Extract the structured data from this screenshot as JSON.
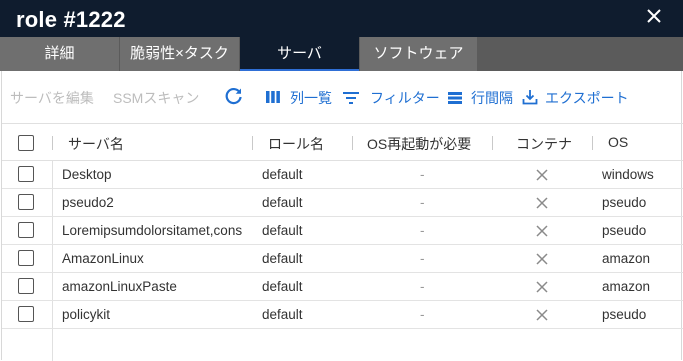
{
  "window": {
    "title": "role #1222",
    "close_icon": "close-icon"
  },
  "tabs": [
    {
      "label": "詳細",
      "active": false
    },
    {
      "label": "脆弱性×タスク",
      "active": false
    },
    {
      "label": "サーバ",
      "active": true
    },
    {
      "label": "ソフトウェア",
      "active": false
    }
  ],
  "toolbar": {
    "edit_servers": "サーバを編集",
    "ssm_scan": "SSMスキャン",
    "refresh_icon": "refresh-icon",
    "columns": "列一覧",
    "filter": "フィルター",
    "density": "行間隔",
    "export": "エクスポート"
  },
  "table": {
    "headers": [
      "サーバ名",
      "ロール名",
      "OS再起動が必要",
      "コンテナ",
      "OS"
    ],
    "rows": [
      {
        "server": "Desktop",
        "role": "default",
        "reboot": "-",
        "container": "x-icon",
        "os": "windows"
      },
      {
        "server": "pseudo2",
        "role": "default",
        "reboot": "-",
        "container": "x-icon",
        "os": "pseudo"
      },
      {
        "server": "Loremipsumdolorsitamet,cons",
        "role": "default",
        "reboot": "-",
        "container": "x-icon",
        "os": "pseudo"
      },
      {
        "server": "AmazonLinux",
        "role": "default",
        "reboot": "-",
        "container": "x-icon",
        "os": "amazon"
      },
      {
        "server": "amazonLinuxPaste",
        "role": "default",
        "reboot": "-",
        "container": "x-icon",
        "os": "amazon"
      },
      {
        "server": "policykit",
        "role": "default",
        "reboot": "-",
        "container": "x-icon",
        "os": "pseudo"
      }
    ]
  },
  "colors": {
    "titlebar": "#0f1c2e",
    "tab_bg": "#6f6f6f",
    "accent": "#1f6fd2"
  }
}
